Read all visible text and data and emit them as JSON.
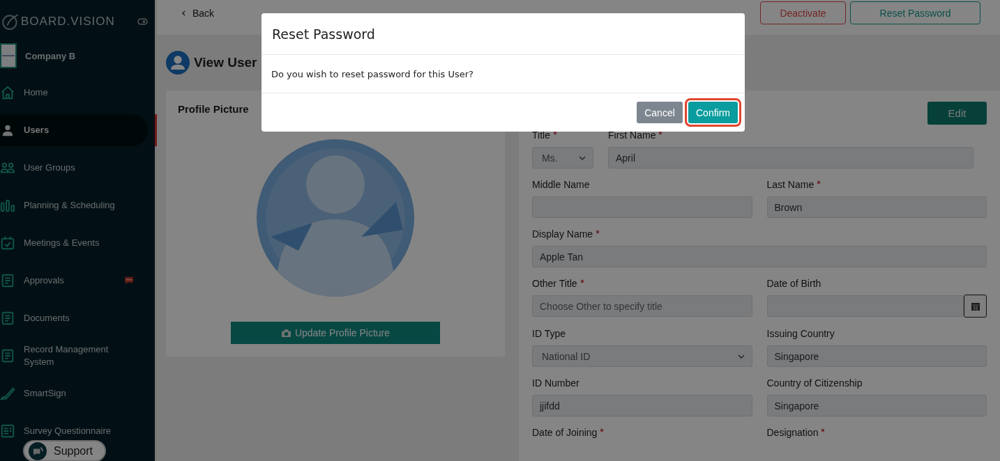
{
  "sidebar": {
    "brand": "BOARD.VISION",
    "company": {
      "name": "Company B"
    },
    "items": [
      {
        "label": "Home",
        "selected": false
      },
      {
        "label": "Users",
        "selected": true
      },
      {
        "label": "User Groups",
        "selected": false
      },
      {
        "label": "Planning & Scheduling",
        "selected": false
      },
      {
        "label": "Meetings & Events",
        "selected": false
      },
      {
        "label": "Approvals",
        "selected": false,
        "badge": true
      },
      {
        "label": "Documents",
        "selected": false
      },
      {
        "label": "Record Management System",
        "selected": false
      },
      {
        "label": "SmartSign",
        "selected": false
      },
      {
        "label": "Survey Questionnaire",
        "selected": false
      }
    ]
  },
  "support": {
    "label": "Support"
  },
  "topbar": {
    "back": "Back",
    "buttons": [
      {
        "label": "Deactivate",
        "kind": "danger"
      },
      {
        "label": "Reset Password",
        "kind": "primary"
      }
    ]
  },
  "page_title": "View User",
  "profile_card": {
    "title": "Profile Picture",
    "button": "Update Profile Picture"
  },
  "form": {
    "edit": "Edit",
    "rows": [
      [
        {
          "label": "Title",
          "required": true,
          "kind": "select",
          "value": "Ms."
        },
        {
          "label": "First Name",
          "required": true,
          "kind": "text",
          "value": "April"
        }
      ],
      [
        {
          "label": "Middle Name",
          "required": false,
          "kind": "text"
        },
        {
          "label": "Last Name",
          "required": true,
          "kind": "text",
          "value": "Brown"
        }
      ],
      [
        {
          "label": "Display Name",
          "required": true,
          "kind": "text",
          "value": "Apple Tan"
        }
      ],
      [
        {
          "label": "Other Title",
          "required": true,
          "kind": "text",
          "placeholder": "Choose Other to specify title"
        },
        {
          "label": "Date of Birth",
          "required": false,
          "kind": "date"
        }
      ],
      [
        {
          "label": "ID Type",
          "required": false,
          "kind": "select",
          "value": "National ID"
        },
        {
          "label": "Issuing Country",
          "required": false,
          "kind": "text",
          "value": "Singapore"
        }
      ],
      [
        {
          "label": "ID Number",
          "required": false,
          "kind": "text",
          "value": "jjifdd"
        },
        {
          "label": "Country of Citizenship",
          "required": false,
          "kind": "text",
          "value": "Singapore"
        }
      ],
      [
        {
          "label": "Date of Joining",
          "required": true,
          "kind": "cut"
        },
        {
          "label": "Designation",
          "required": true,
          "kind": "cut"
        }
      ]
    ]
  },
  "modal": {
    "title": "Reset Password",
    "message": "Do you wish to reset password for this User?",
    "buttons": [
      {
        "label": "Cancel",
        "kind": "secondary",
        "highlighted": false
      },
      {
        "label": "Confirm",
        "kind": "confirm",
        "highlighted": true
      }
    ]
  }
}
